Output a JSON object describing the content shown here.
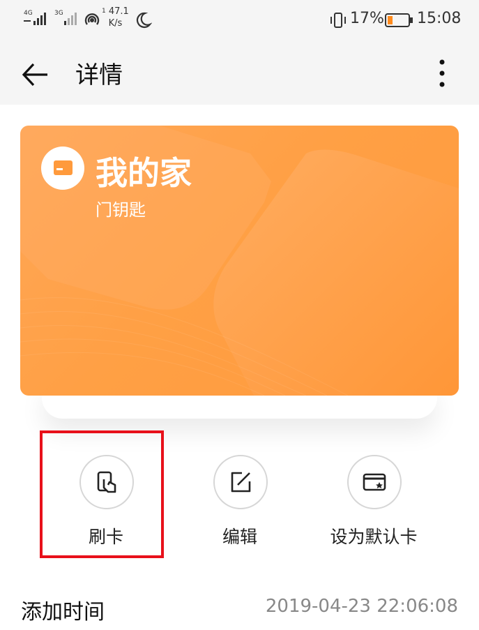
{
  "status_bar": {
    "signal1": "4G",
    "signal2": "3G",
    "speed_value": "47.1",
    "speed_unit": "K/s",
    "speed_prefix": "1",
    "battery": "17%",
    "time": "15:08"
  },
  "header": {
    "title": "详情"
  },
  "card": {
    "title": "我的家",
    "subtitle": "门钥匙",
    "colors": {
      "from": "#ffa757",
      "to": "#ff9a3c"
    }
  },
  "actions": [
    {
      "label": "刷卡",
      "icon": "card-swipe-icon"
    },
    {
      "label": "编辑",
      "icon": "edit-icon"
    },
    {
      "label": "设为默认卡",
      "icon": "default-card-icon"
    }
  ],
  "details": {
    "added_time_label": "添加时间",
    "added_time_value": "2019-04-23 22:06:08"
  },
  "colors": {
    "highlight": "#e8101a",
    "background": "#f5f5f5"
  }
}
